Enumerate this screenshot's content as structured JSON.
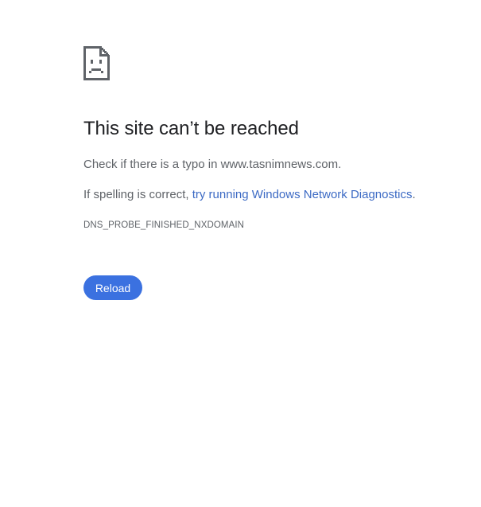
{
  "error_page": {
    "icon": "sad-document-icon",
    "title": "This site can’t be reached",
    "typo_message": "Check if there is a typo in www.tasnimnews.com.",
    "spelling_prefix": "If spelling is correct, ",
    "diagnostics_link": "try running Windows Network Diagnostics",
    "spelling_suffix": ".",
    "error_code": "DNS_PROBE_FINISHED_NXDOMAIN",
    "reload_label": "Reload"
  },
  "colors": {
    "title": "#202124",
    "body_text": "#5f6368",
    "link": "#3c6ac4",
    "button": "#3b71e0",
    "icon": "#5f6368"
  }
}
